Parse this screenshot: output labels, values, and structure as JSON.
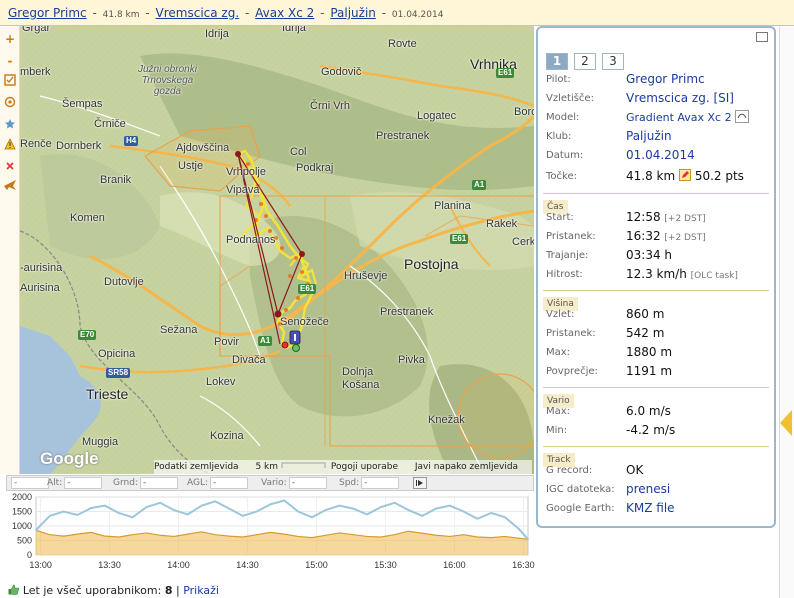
{
  "header": {
    "pilot": "Gregor Primc",
    "distance": "41.8 km",
    "launch": "Vremscica zg.",
    "glider": "Avax Xc 2",
    "club": "Paljužin",
    "date": "01.04.2014",
    "sep": "-"
  },
  "toolbar": {
    "zoom_in": "+",
    "zoom_out": "-",
    "icons": [
      "zoom-in-icon",
      "zoom-out-icon",
      "checkbox-icon",
      "layers-icon",
      "star-icon",
      "warning-icon",
      "close-icon",
      "plane-icon"
    ]
  },
  "map": {
    "places": {
      "grgar": "Grgar",
      "idrija": "Idrija",
      "rovte": "Rovte",
      "vrhnika": "Vrhnika",
      "godovic": "Godovič",
      "semberk": "mberk",
      "sempas": "Šempas",
      "trnovo": "Južni obronki\nTrnovskega\ngozda",
      "crni_vrh": "Črni Vrh",
      "logatec": "Logatec",
      "boro": "Boro",
      "crnice": "Črniče",
      "dornberk": "Dornberk",
      "ajdovscina": "Ajdovščina",
      "col": "Col",
      "podkraj": "Podkraj",
      "prestranek_top": "Prestranek",
      "rence": "Renče",
      "ustje": "Ustje",
      "vrhpolje": "Vrhpolje",
      "branik": "Branik",
      "vipava": "Vipava",
      "planina": "Planina",
      "komen": "Komen",
      "podnanos": "Podnanos",
      "rakek": "Rakek",
      "cerk": "Cerk",
      "aurisina1": "-aurisina",
      "hrusevje": "Hruševje",
      "postojna": "Postojna",
      "dutovlje": "Dutovlje",
      "aurisina2": "Aurisina",
      "prestranek": "Prestranek",
      "senozece": "Senožeče",
      "sezana": "Sežana",
      "opicina": "Opicina",
      "povir": "Povir",
      "divaca": "Divača",
      "pivka": "Pivka",
      "dolnja_kosana": "Dolnja\nKošana",
      "trieste": "Trieste",
      "lokev": "Lokev",
      "knezak": "Knežak",
      "muggia": "Muggia",
      "kozina": "Kozina"
    },
    "roads": {
      "e61_top": "E61",
      "h4": "H4",
      "a1_1": "A1",
      "e61_mid": "E61",
      "e61_v": "E61",
      "e70": "E70",
      "sr58": "SR58",
      "a1_2": "A1"
    },
    "google_logo": "Google",
    "footer": {
      "data": "Podatki zemljevida",
      "scale": "5 km",
      "terms": "Pogoji uporabe",
      "report": "Javi napako zemljevida"
    }
  },
  "panel": {
    "tabs": [
      "1",
      "2",
      "3"
    ],
    "active_tab": "1",
    "pilot_label": "Pilot:",
    "pilot": "Gregor Primc",
    "launch_label": "Vzletišče:",
    "launch": "Vremscica zg. [SI]",
    "model_label": "Model:",
    "model": "Gradient Avax Xc 2",
    "club_label": "Klub:",
    "club": "Paljužin",
    "date_label": "Datum:",
    "date": "01.04.2014",
    "points_label": "Točke:",
    "distance": "41.8 km",
    "points": "50.2 pts",
    "time_section": "Čas",
    "start_label": "Start:",
    "start": "12:58",
    "start_dst": "[+2 DST]",
    "landing_label": "Pristanek:",
    "landing": "16:32",
    "landing_dst": "[+2 DST]",
    "duration_label": "Trajanje:",
    "duration": "03:34 h",
    "speed_label": "Hitrost:",
    "speed": "12.3 km/h",
    "speed_note": "[OLC task]",
    "alt_section": "Višina",
    "takeoff_label": "Vzlet:",
    "takeoff_alt": "860 m",
    "landing_alt_label": "Pristanek:",
    "landing_alt": "542 m",
    "max_label": "Max:",
    "max_alt": "1880 m",
    "avg_label": "Povprečje:",
    "avg_alt": "1191 m",
    "vario_section": "Vario",
    "vmax_label": "Max:",
    "vmax": "6.0 m/s",
    "vmin_label": "Min:",
    "vmin": "-4.2 m/s",
    "track_section": "Track",
    "grecord_label": "G record:",
    "grecord": "OK",
    "igc_label": "IGC datoteka:",
    "igc": "prenesi",
    "ge_label": "Google Earth:",
    "ge": "KMZ file"
  },
  "databar": {
    "time_value": "-",
    "alt_label": "Alt:",
    "alt_value": "-",
    "grnd_label": "Grnd:",
    "grnd_value": "-",
    "agl_label": "AGL:",
    "agl_value": "-",
    "vario_label": "Vario:",
    "vario_value": "-",
    "spd_label": "Spd:",
    "spd_value": "-"
  },
  "chart_data": {
    "type": "area",
    "title": "",
    "xlabel": "",
    "ylabel": "",
    "ylim": [
      0,
      2000
    ],
    "yticks": [
      "2000",
      "1500",
      "1000",
      "500",
      "0"
    ],
    "xticks": [
      "13:00",
      "13:30",
      "14:00",
      "14:30",
      "15:00",
      "15:30",
      "16:00",
      "16:30"
    ],
    "x": [
      "12:58",
      "13:04",
      "13:10",
      "13:16",
      "13:22",
      "13:28",
      "13:34",
      "13:40",
      "13:46",
      "13:52",
      "13:58",
      "14:04",
      "14:10",
      "14:16",
      "14:22",
      "14:28",
      "14:34",
      "14:40",
      "14:46",
      "14:52",
      "14:58",
      "15:04",
      "15:10",
      "15:16",
      "15:22",
      "15:28",
      "15:34",
      "15:40",
      "15:46",
      "15:52",
      "15:58",
      "16:04",
      "16:10",
      "16:16",
      "16:22",
      "16:28",
      "16:32"
    ],
    "series": [
      {
        "values": [
          860,
          1350,
          1500,
          1380,
          1620,
          1700,
          1450,
          1300,
          1650,
          1800,
          1550,
          1400,
          1700,
          1850,
          1600,
          1350,
          1500,
          1750,
          1880,
          1500,
          1300,
          1550,
          1700,
          1600,
          1400,
          1650,
          1800,
          1550,
          1350,
          1600,
          1700,
          1500,
          1250,
          1450,
          1300,
          900,
          542
        ],
        "color": "#9cc6dc"
      },
      {
        "values": [
          850,
          700,
          650,
          720,
          780,
          650,
          620,
          700,
          760,
          680,
          640,
          720,
          800,
          700,
          650,
          620,
          700,
          780,
          720,
          640,
          600,
          680,
          760,
          700,
          640,
          620,
          700,
          820,
          750,
          680,
          640,
          700,
          620,
          600,
          640,
          580,
          540
        ],
        "color": "#f0b84a"
      }
    ]
  },
  "footer": {
    "like_text": "Let je všeč uporabnikom:",
    "like_count": "8",
    "sep": "|",
    "show": "Prikaži"
  }
}
